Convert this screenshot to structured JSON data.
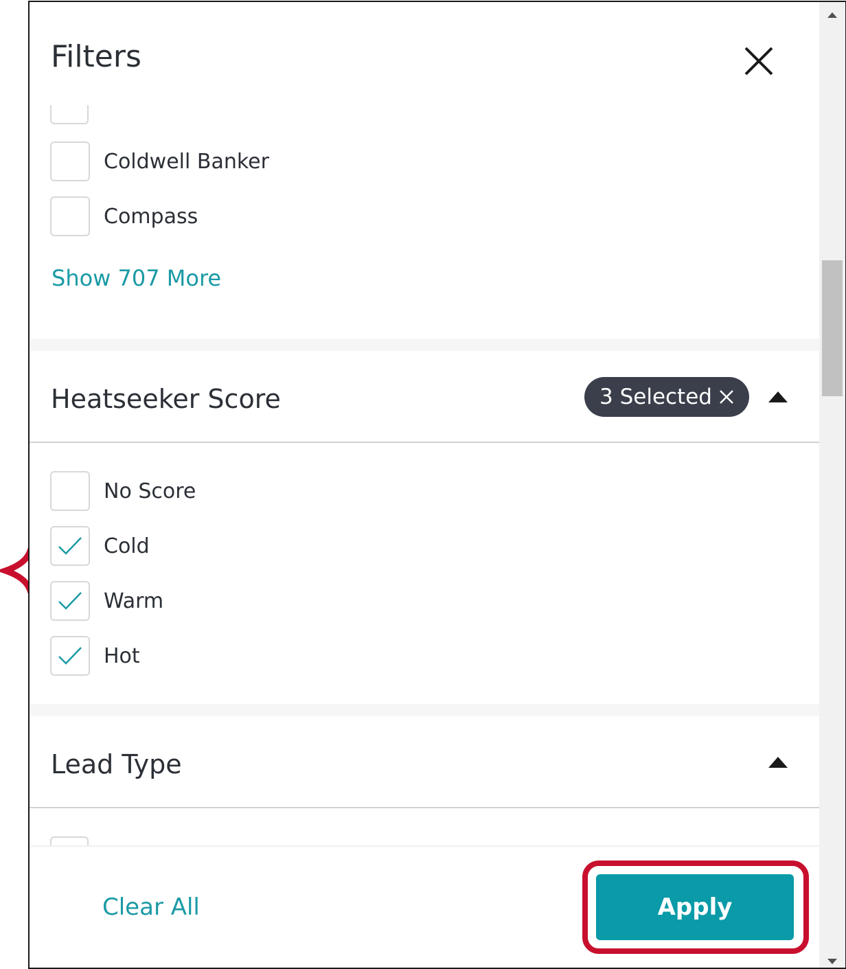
{
  "header": {
    "title": "Filters"
  },
  "brokerage": {
    "items": [
      {
        "label": "Coldwell Banker",
        "checked": false
      },
      {
        "label": "Compass",
        "checked": false
      }
    ],
    "show_more": "Show 707 More"
  },
  "heatseeker": {
    "title": "Heatseeker Score",
    "badge": "3 Selected",
    "items": [
      {
        "label": "No Score",
        "checked": false
      },
      {
        "label": "Cold",
        "checked": true
      },
      {
        "label": "Warm",
        "checked": true
      },
      {
        "label": "Hot",
        "checked": true
      }
    ]
  },
  "lead_type": {
    "title": "Lead Type"
  },
  "footer": {
    "clear_all": "Clear All",
    "apply": "Apply"
  },
  "colors": {
    "accent": "#0a9aa8",
    "link": "#1a9aa5",
    "annotation": "#c8102e",
    "badge_bg": "#3a3f4b"
  }
}
